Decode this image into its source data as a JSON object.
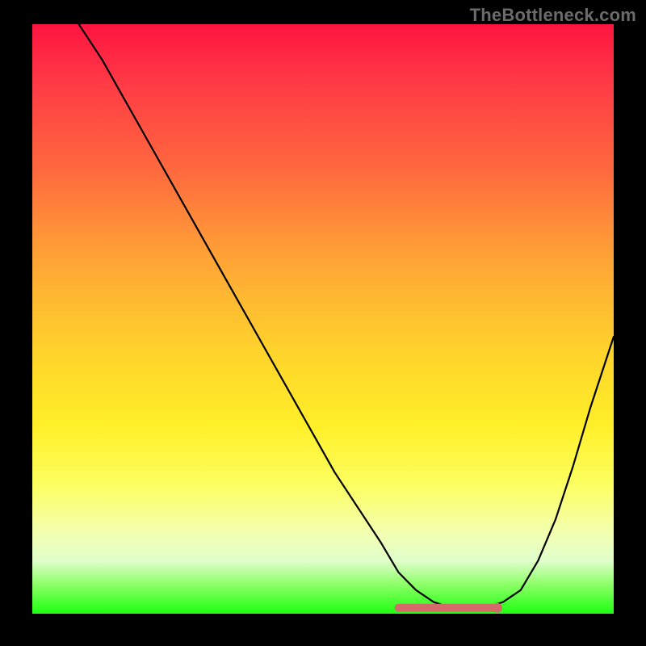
{
  "watermark": "TheBottleneck.com",
  "chart_data": {
    "type": "line",
    "title": "",
    "xlabel": "",
    "ylabel": "",
    "xlim": [
      0,
      100
    ],
    "ylim": [
      0,
      100
    ],
    "gradient_stops": [
      {
        "pct": 0,
        "color": "#ff1440"
      },
      {
        "pct": 10,
        "color": "#ff3a46"
      },
      {
        "pct": 25,
        "color": "#ff6a3e"
      },
      {
        "pct": 40,
        "color": "#ffa436"
      },
      {
        "pct": 55,
        "color": "#ffd22c"
      },
      {
        "pct": 68,
        "color": "#ffef28"
      },
      {
        "pct": 78,
        "color": "#fcff60"
      },
      {
        "pct": 86,
        "color": "#f4ffae"
      },
      {
        "pct": 91,
        "color": "#e0ffcc"
      },
      {
        "pct": 95,
        "color": "#8dff68"
      },
      {
        "pct": 100,
        "color": "#1eff10"
      }
    ],
    "series": [
      {
        "name": "bottleneck-curve",
        "x": [
          8,
          12,
          16,
          20,
          24,
          28,
          32,
          36,
          40,
          44,
          48,
          52,
          56,
          60,
          63,
          66,
          69,
          72,
          75,
          78,
          81,
          84,
          87,
          90,
          93,
          96,
          100
        ],
        "y": [
          100,
          94,
          87,
          80,
          73,
          66,
          59,
          52,
          45,
          38,
          31,
          24,
          18,
          12,
          7,
          4,
          2,
          1,
          1,
          1,
          2,
          4,
          9,
          16,
          25,
          35,
          47
        ]
      }
    ],
    "highlight_segment": {
      "name": "optimal-range",
      "color": "#d46a6a",
      "x_start": 63,
      "x_end": 80,
      "y": 1
    },
    "highlight_point": {
      "x": 80,
      "y": 1,
      "color": "#d46a6a"
    }
  }
}
